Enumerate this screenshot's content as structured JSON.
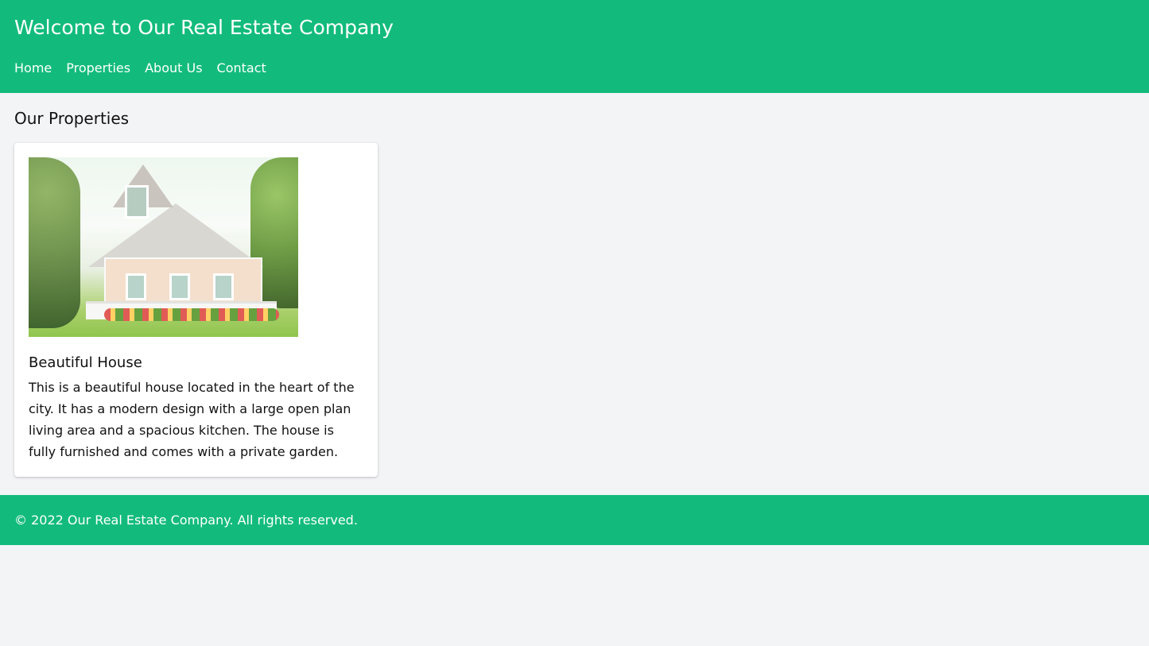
{
  "header": {
    "title": "Welcome to Our Real Estate Company",
    "nav": [
      {
        "label": "Home"
      },
      {
        "label": "Properties"
      },
      {
        "label": "About Us"
      },
      {
        "label": "Contact"
      }
    ]
  },
  "main": {
    "section_title": "Our Properties",
    "properties": [
      {
        "title": "Beautiful House",
        "description": "This is a beautiful house located in the heart of the city. It has a modern design with a large open plan living area and a spacious kitchen. The house is fully furnished and comes with a private garden."
      }
    ]
  },
  "footer": {
    "text": "© 2022 Our Real Estate Company. All rights reserved."
  },
  "colors": {
    "primary": "#12bb7c",
    "background": "#f3f4f6",
    "card": "#ffffff"
  }
}
